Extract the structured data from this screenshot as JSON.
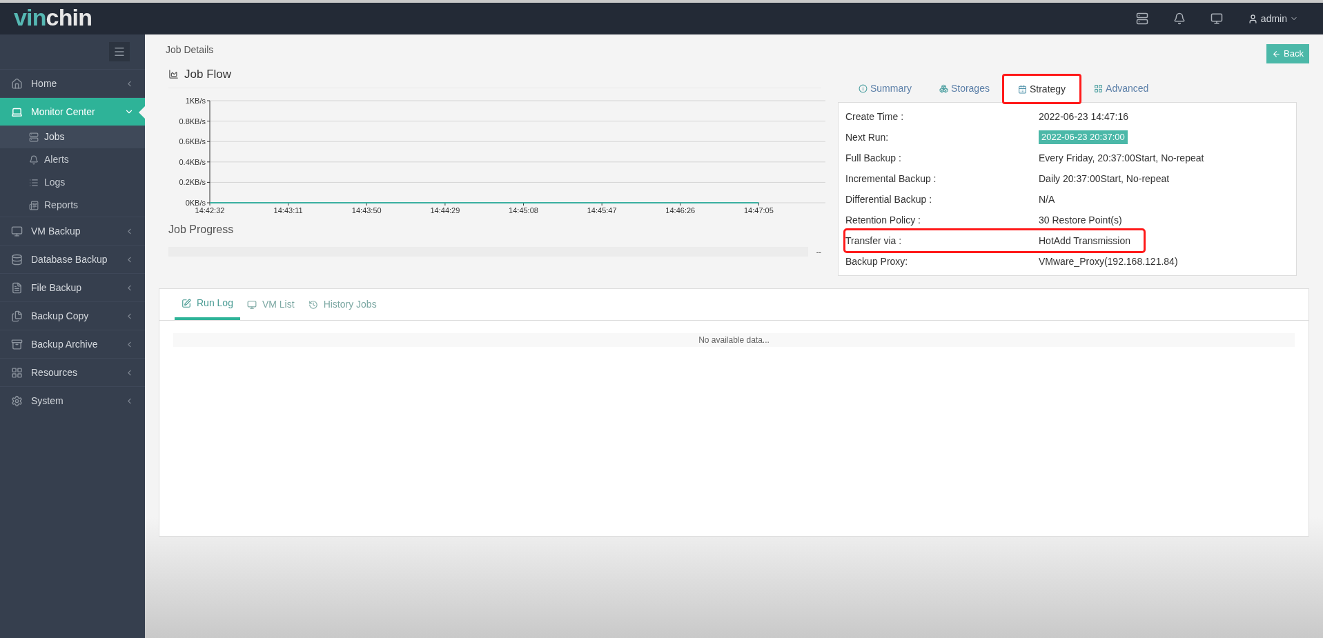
{
  "header": {
    "logo_part_1": "vin",
    "logo_part_2": "chin",
    "user": "admin"
  },
  "sidebar": {
    "items": [
      {
        "label": "Home",
        "selected": false,
        "expanded": false
      },
      {
        "label": "Monitor Center",
        "selected": true,
        "expanded": true,
        "children": [
          {
            "label": "Jobs",
            "selected": true
          },
          {
            "label": "Alerts",
            "selected": false
          },
          {
            "label": "Logs",
            "selected": false
          },
          {
            "label": "Reports",
            "selected": false
          }
        ]
      },
      {
        "label": "VM Backup",
        "selected": false,
        "expanded": false
      },
      {
        "label": "Database Backup",
        "selected": false,
        "expanded": false
      },
      {
        "label": "File Backup",
        "selected": false,
        "expanded": false
      },
      {
        "label": "Backup Copy",
        "selected": false,
        "expanded": false
      },
      {
        "label": "Backup Archive",
        "selected": false,
        "expanded": false
      },
      {
        "label": "Resources",
        "selected": false,
        "expanded": false
      },
      {
        "label": "System",
        "selected": false,
        "expanded": false
      }
    ]
  },
  "page_title": "Job Details",
  "back_button": "Back",
  "job_flow": {
    "title": "Job Flow",
    "chart_data": {
      "type": "line",
      "categories": [
        "14:42:32",
        "14:43:11",
        "14:43:50",
        "14:44:29",
        "14:45:08",
        "14:45:47",
        "14:46:26",
        "14:47:05"
      ],
      "series": [
        {
          "color": "#3aafa0",
          "values": [
            0,
            0,
            0,
            0,
            0,
            0,
            0,
            0
          ]
        }
      ],
      "grid": true,
      "ylim": [
        0,
        1
      ],
      "yticks": [
        {
          "value": 0,
          "label": "0KB/s"
        },
        {
          "value": 0.2,
          "label": "0.2KB/s"
        },
        {
          "value": 0.4,
          "label": "0.4KB/s"
        },
        {
          "value": 0.6,
          "label": "0.6KB/s"
        },
        {
          "value": 0.8,
          "label": "0.8KB/s"
        },
        {
          "value": 1,
          "label": "1KB/s"
        }
      ]
    }
  },
  "job_progress": {
    "title": "Job Progress",
    "level": 0,
    "reading": "--"
  },
  "detail_tabs": [
    {
      "label": "Summary",
      "selected": false,
      "highlighted": false
    },
    {
      "label": "Storages",
      "selected": false,
      "highlighted": false
    },
    {
      "label": "Strategy",
      "selected": true,
      "highlighted": true
    },
    {
      "label": "Advanced",
      "selected": false,
      "highlighted": false
    }
  ],
  "strategy": [
    {
      "label": "Create Time :",
      "value": "2022-06-23 14:47:16",
      "kind": "text",
      "highlighted": false
    },
    {
      "label": "Next Run:",
      "value": "2022-06-23 20:37:00",
      "kind": "badge",
      "highlighted": false
    },
    {
      "label": "Full Backup :",
      "value": "Every Friday, 20:37:00Start, No-repeat",
      "kind": "text",
      "highlighted": false
    },
    {
      "label": "Incremental Backup :",
      "value": "Daily 20:37:00Start, No-repeat",
      "kind": "text",
      "highlighted": false
    },
    {
      "label": "Differential Backup :",
      "value": "N/A",
      "kind": "text",
      "highlighted": false
    },
    {
      "label": "Retention Policy :",
      "value": "30 Restore Point(s)",
      "kind": "text",
      "highlighted": false
    },
    {
      "label": "Transfer via :",
      "value": "HotAdd Transmission",
      "kind": "text",
      "highlighted": true
    },
    {
      "label": "Backup Proxy:",
      "value": "VMware_Proxy(192.168.121.84)",
      "kind": "text",
      "highlighted": false
    }
  ],
  "log_tabs": [
    {
      "label": "Run Log",
      "selected": true
    },
    {
      "label": "VM List",
      "selected": false
    },
    {
      "label": "History Jobs",
      "selected": false
    }
  ],
  "log_empty": "No available data..."
}
